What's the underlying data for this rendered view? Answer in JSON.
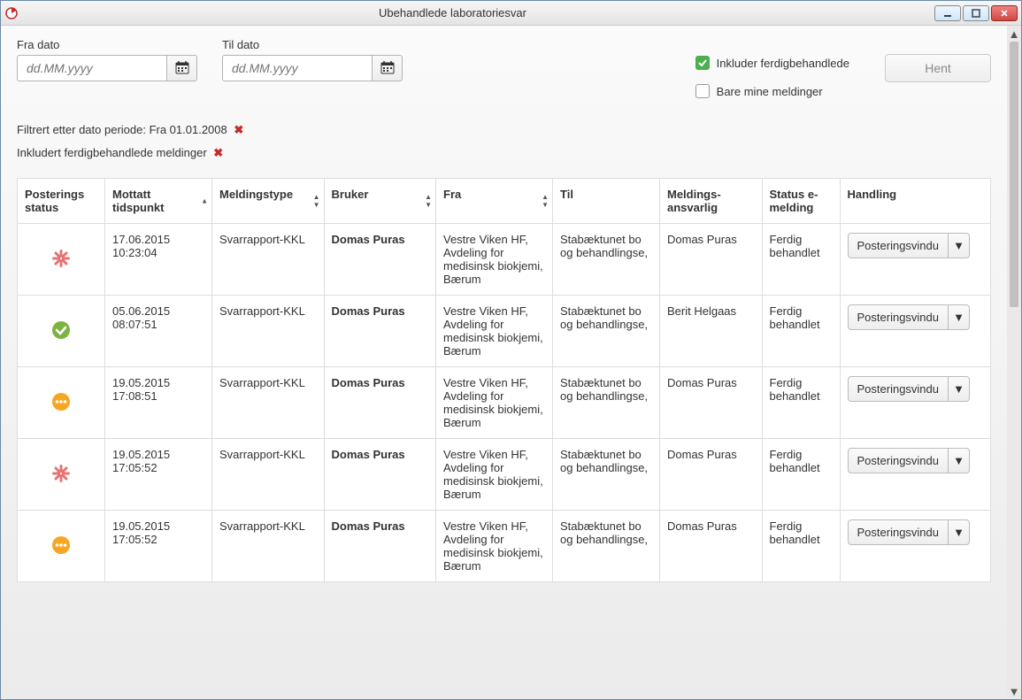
{
  "window": {
    "title": "Ubehandlede laboratoriesvar"
  },
  "filters": {
    "from_label": "Fra dato",
    "to_label": "Til dato",
    "placeholder": "dd.MM.yyyy",
    "include_label": "Inkluder ferdigbehandlede",
    "mine_label": "Bare mine meldinger",
    "hent_label": "Hent"
  },
  "applied": {
    "line1": "Filtrert etter dato periode: Fra 01.01.2008",
    "line2": "Inkludert ferdigbehandlede meldinger"
  },
  "headers": {
    "status": "Posterings status",
    "mottatt": "Mottatt tidspunkt",
    "type": "Meldingstype",
    "bruker": "Bruker",
    "fra": "Fra",
    "til": "Til",
    "ansvarlig": "Meldings-ansvarlig",
    "emelding": "Status e-melding",
    "handling": "Handling"
  },
  "action_label": "Posteringsvindu",
  "rows": [
    {
      "status": "red-asterisk",
      "mottatt": "17.06.2015 10:23:04",
      "type": "Svarrapport-KKL",
      "bruker": "Domas Puras",
      "fra": "Vestre Viken HF, Avdeling for medisinsk biokjemi, Bærum",
      "til": "Stabæktunet bo og behandlingse,",
      "ansvarlig": "Domas Puras",
      "emelding": "Ferdig behandlet"
    },
    {
      "status": "green-check",
      "mottatt": "05.06.2015 08:07:51",
      "type": "Svarrapport-KKL",
      "bruker": "Domas Puras",
      "fra": "Vestre Viken HF, Avdeling for medisinsk biokjemi, Bærum",
      "til": "Stabæktunet bo og behandlingse,",
      "ansvarlig": "Berit Helgaas",
      "emelding": "Ferdig behandlet"
    },
    {
      "status": "orange-dots",
      "mottatt": "19.05.2015 17:08:51",
      "type": "Svarrapport-KKL",
      "bruker": "Domas Puras",
      "fra": "Vestre Viken HF, Avdeling for medisinsk biokjemi, Bærum",
      "til": "Stabæktunet bo og behandlingse,",
      "ansvarlig": "Domas Puras",
      "emelding": "Ferdig behandlet"
    },
    {
      "status": "red-asterisk",
      "mottatt": "19.05.2015 17:05:52",
      "type": "Svarrapport-KKL",
      "bruker": "Domas Puras",
      "fra": "Vestre Viken HF, Avdeling for medisinsk biokjemi, Bærum",
      "til": "Stabæktunet bo og behandlingse,",
      "ansvarlig": "Domas Puras",
      "emelding": "Ferdig behandlet"
    },
    {
      "status": "orange-dots",
      "mottatt": "19.05.2015 17:05:52",
      "type": "Svarrapport-KKL",
      "bruker": "Domas Puras",
      "fra": "Vestre Viken HF, Avdeling for medisinsk biokjemi, Bærum",
      "til": "Stabæktunet bo og behandlingse,",
      "ansvarlig": "Domas Puras",
      "emelding": "Ferdig behandlet"
    }
  ]
}
